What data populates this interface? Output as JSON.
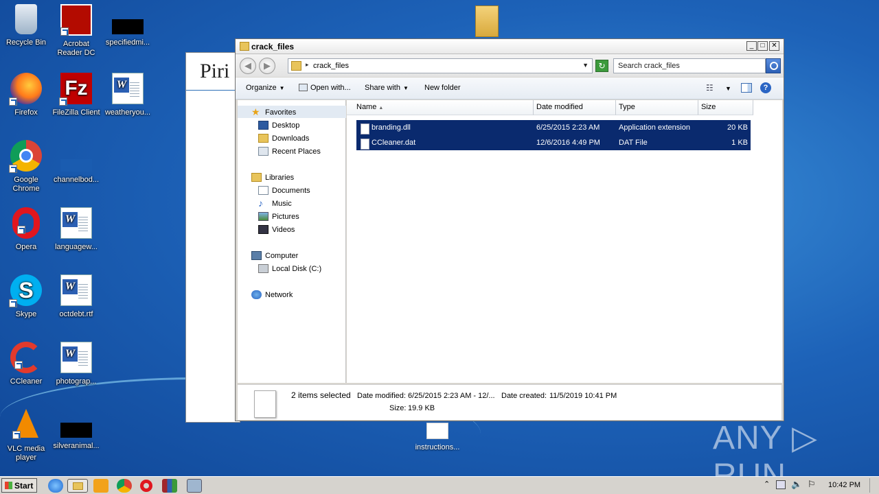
{
  "desktop": {
    "icons": [
      {
        "label": "Recycle Bin"
      },
      {
        "label": "Acrobat Reader DC"
      },
      {
        "label": "specifiedmi..."
      },
      {
        "label": "Firefox"
      },
      {
        "label": "FileZilla Client"
      },
      {
        "label": "weatheryou..."
      },
      {
        "label": "Google Chrome"
      },
      {
        "label": "channelbod..."
      },
      {
        "label": "Opera"
      },
      {
        "label": "languagew..."
      },
      {
        "label": "Skype"
      },
      {
        "label": "octdebt.rtf"
      },
      {
        "label": "CCleaner"
      },
      {
        "label": "photograp..."
      },
      {
        "label": "VLC media player"
      },
      {
        "label": "silveranimal..."
      }
    ],
    "bottom_file": "instructions...",
    "watermark": "ANY ▷ RUN",
    "background_window_title": "Piri"
  },
  "explorer": {
    "title": "crack_files",
    "address_path": "crack_files",
    "search_placeholder": "Search crack_files",
    "toolbar": {
      "organize": "Organize",
      "open_with": "Open with...",
      "share_with": "Share with",
      "new_folder": "New folder"
    },
    "nav": {
      "favorites": "Favorites",
      "desktop": "Desktop",
      "downloads": "Downloads",
      "recent_places": "Recent Places",
      "libraries": "Libraries",
      "documents": "Documents",
      "music": "Music",
      "pictures": "Pictures",
      "videos": "Videos",
      "computer": "Computer",
      "local_disk": "Local Disk (C:)",
      "network": "Network"
    },
    "columns": {
      "name": "Name",
      "date_modified": "Date modified",
      "type": "Type",
      "size": "Size"
    },
    "files": [
      {
        "name": "branding.dll",
        "date": "6/25/2015 2:23 AM",
        "type": "Application extension",
        "size": "20 KB"
      },
      {
        "name": "CCleaner.dat",
        "date": "12/6/2016 4:49 PM",
        "type": "DAT File",
        "size": "1 KB"
      }
    ],
    "details": {
      "selected": "2 items selected",
      "date_modified_label": "Date modified:",
      "date_modified_value": "6/25/2015 2:23 AM - 12/...",
      "date_created_label": "Date created:",
      "date_created_value": "11/5/2019 10:41 PM",
      "size_label": "Size:",
      "size_value": "19.9 KB"
    }
  },
  "taskbar": {
    "start": "Start",
    "clock": "10:42 PM"
  }
}
